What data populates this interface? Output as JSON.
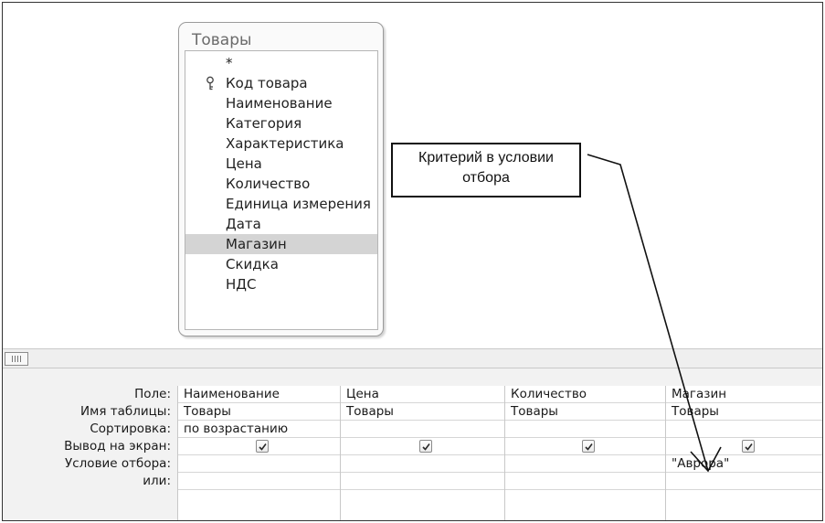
{
  "field_list": {
    "title": "Товары",
    "items": [
      {
        "label": "*",
        "key": false,
        "selected": false
      },
      {
        "label": "Код товара",
        "key": true,
        "selected": false
      },
      {
        "label": "Наименование",
        "key": false,
        "selected": false
      },
      {
        "label": "Категория",
        "key": false,
        "selected": false
      },
      {
        "label": "Характеристика",
        "key": false,
        "selected": false
      },
      {
        "label": "Цена",
        "key": false,
        "selected": false
      },
      {
        "label": "Количество",
        "key": false,
        "selected": false
      },
      {
        "label": "Единица измерения",
        "key": false,
        "selected": false
      },
      {
        "label": "Дата",
        "key": false,
        "selected": false
      },
      {
        "label": "Магазин",
        "key": false,
        "selected": true
      },
      {
        "label": "Скидка",
        "key": false,
        "selected": false
      },
      {
        "label": "НДС",
        "key": false,
        "selected": false
      }
    ]
  },
  "callout": {
    "line1": "Критерий в условии",
    "line2": "отбора"
  },
  "grid": {
    "row_labels": {
      "field": "Поле:",
      "table": "Имя таблицы:",
      "sort": "Сортировка:",
      "show": "Вывод на экран:",
      "criteria": "Условие отбора:",
      "or": "или:"
    },
    "columns": [
      {
        "field": "Наименование",
        "table": "Товары",
        "sort": "по возрастанию",
        "show": true,
        "criteria": ""
      },
      {
        "field": "Цена",
        "table": "Товары",
        "sort": "",
        "show": true,
        "criteria": ""
      },
      {
        "field": "Количество",
        "table": "Товары",
        "sort": "",
        "show": true,
        "criteria": ""
      },
      {
        "field": "Магазин",
        "table": "Товары",
        "sort": "",
        "show": true,
        "criteria": "\"Аврора\""
      }
    ]
  },
  "icons": {
    "key": "key-icon",
    "checkbox": "checkmark-icon",
    "scroll_thumb": "scroll-thumb-grip"
  },
  "colors": {
    "selected_row": "#d4d4d4",
    "panel_background": "#f2f2f2",
    "check_mark": "#2a2a2a"
  }
}
